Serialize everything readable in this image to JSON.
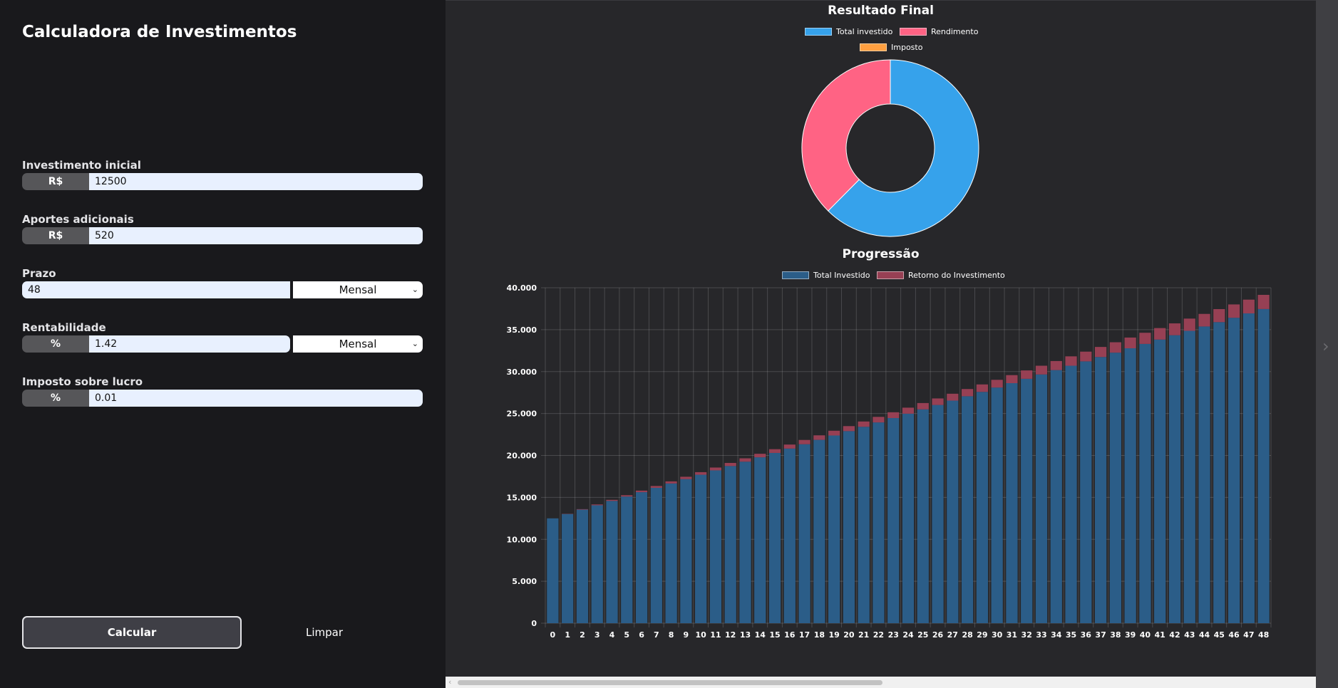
{
  "app": {
    "title": "Calculadora de Investimentos"
  },
  "form": {
    "initial": {
      "label": "Investimento inicial",
      "prefix": "R$",
      "value": "12500"
    },
    "contributions": {
      "label": "Aportes adicionais",
      "prefix": "R$",
      "value": "520"
    },
    "term": {
      "label": "Prazo",
      "value": "48",
      "period": "Mensal"
    },
    "rate": {
      "label": "Rentabilidade",
      "prefix": "%",
      "value": "1.42",
      "period": "Mensal"
    },
    "tax": {
      "label": "Imposto sobre lucro",
      "prefix": "%",
      "value": "0.01"
    },
    "calculate_label": "Calcular",
    "clear_label": "Limpar"
  },
  "colors": {
    "invested": "#36a2eb",
    "return": "#ff6384",
    "tax": "#ff9f40",
    "bar_invested": "#2b5d88",
    "bar_return": "#974054"
  },
  "icons": {
    "select_chevron": "chevron-down-icon",
    "scroll_right": "chevron-right-icon",
    "scroll_left": "chevron-left-icon"
  },
  "chart_data": [
    {
      "type": "pie",
      "variant": "doughnut",
      "title": "Resultado Final",
      "legend": [
        "Total investido",
        "Rendimento",
        "Imposto"
      ],
      "values": [
        37460,
        22540,
        2.25
      ],
      "legend_position": "top"
    },
    {
      "type": "bar",
      "stacked": true,
      "title": "Progressão",
      "categories": [
        0,
        1,
        2,
        3,
        4,
        5,
        6,
        7,
        8,
        9,
        10,
        11,
        12,
        13,
        14,
        15,
        16,
        17,
        18,
        19,
        20,
        21,
        22,
        23,
        24,
        25,
        26,
        27,
        28,
        29,
        30,
        31,
        32,
        33,
        34,
        35,
        36,
        37,
        38,
        39,
        40,
        41,
        42,
        43,
        44,
        45,
        46,
        47,
        48
      ],
      "series": [
        {
          "name": "Total Investido",
          "values": [
            12500,
            13020,
            13540,
            14060,
            14580,
            15100,
            15620,
            16140,
            16660,
            17180,
            17700,
            18220,
            18740,
            19260,
            19780,
            20300,
            20820,
            21340,
            21860,
            22380,
            22900,
            23420,
            23940,
            24460,
            24980,
            25500,
            26020,
            26540,
            27060,
            27580,
            28100,
            28620,
            29140,
            29660,
            30180,
            30700,
            31220,
            31740,
            32260,
            32780,
            33300,
            33820,
            34340,
            34860,
            35380,
            35900,
            36420,
            36940,
            37460
          ]
        },
        {
          "name": "Retorno do Investimento",
          "values": [
            0,
            30,
            60,
            100,
            130,
            160,
            190,
            220,
            250,
            280,
            310,
            340,
            370,
            400,
            420,
            450,
            480,
            510,
            540,
            570,
            600,
            630,
            660,
            690,
            720,
            750,
            780,
            820,
            860,
            890,
            920,
            960,
            1000,
            1040,
            1080,
            1120,
            1160,
            1200,
            1240,
            1280,
            1330,
            1370,
            1410,
            1460,
            1500,
            1550,
            1590,
            1640,
            1690
          ]
        }
      ],
      "ylim": [
        0,
        40000
      ],
      "yticks": [
        "0",
        "5.000",
        "10.000",
        "15.000",
        "20.000",
        "25.000",
        "30.000",
        "35.000",
        "40.000"
      ],
      "grid": true,
      "legend_position": "top"
    }
  ]
}
